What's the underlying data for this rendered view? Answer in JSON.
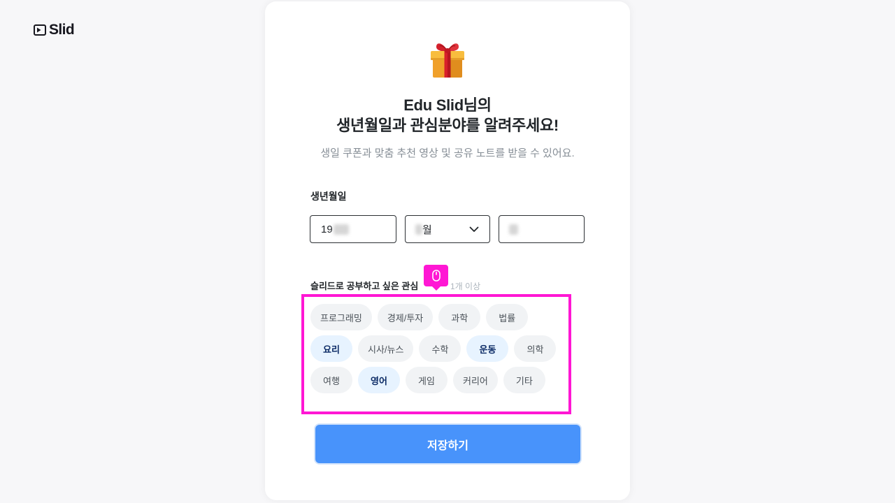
{
  "app": {
    "logo_text": "Slid"
  },
  "header": {
    "title_line1": "Edu Slid님의",
    "title_line2": "생년월일과 관심분야를 알려주세요!",
    "subtitle": "생일 쿠폰과 맞춤 추천 영상 및 공유 노트를 받을 수 있어요."
  },
  "birthdate": {
    "label": "생년월일",
    "year_value": "19",
    "month_value": "월"
  },
  "interests": {
    "label": "슬리드로 공부하고 싶은 관심",
    "hint": "1개 이상",
    "options": [
      {
        "label": "프로그래밍",
        "selected": false
      },
      {
        "label": "경제/투자",
        "selected": false
      },
      {
        "label": "과학",
        "selected": false
      },
      {
        "label": "법률",
        "selected": false
      },
      {
        "label": "요리",
        "selected": true
      },
      {
        "label": "시사/뉴스",
        "selected": false
      },
      {
        "label": "수학",
        "selected": false
      },
      {
        "label": "운동",
        "selected": true
      },
      {
        "label": "의학",
        "selected": false
      },
      {
        "label": "여행",
        "selected": false
      },
      {
        "label": "영어",
        "selected": true
      },
      {
        "label": "게임",
        "selected": false
      },
      {
        "label": "커리어",
        "selected": false
      },
      {
        "label": "기타",
        "selected": false
      }
    ]
  },
  "save_button": {
    "label": "저장하기"
  },
  "icons": {
    "logo": "slid-play-logo-icon",
    "header": "gift-icon",
    "month_dropdown": "chevron-down-icon",
    "cursor_badge": "mouse-icon"
  },
  "colors": {
    "accent": "#4893fb",
    "chip_bg": "#f1f3f5",
    "chip_text": "#495057",
    "chip_selected_bg": "#e7f3ff",
    "chip_selected_text": "#0c2b66",
    "highlight": "#ff17d4",
    "text_primary": "#212529",
    "text_secondary": "#868e96"
  }
}
